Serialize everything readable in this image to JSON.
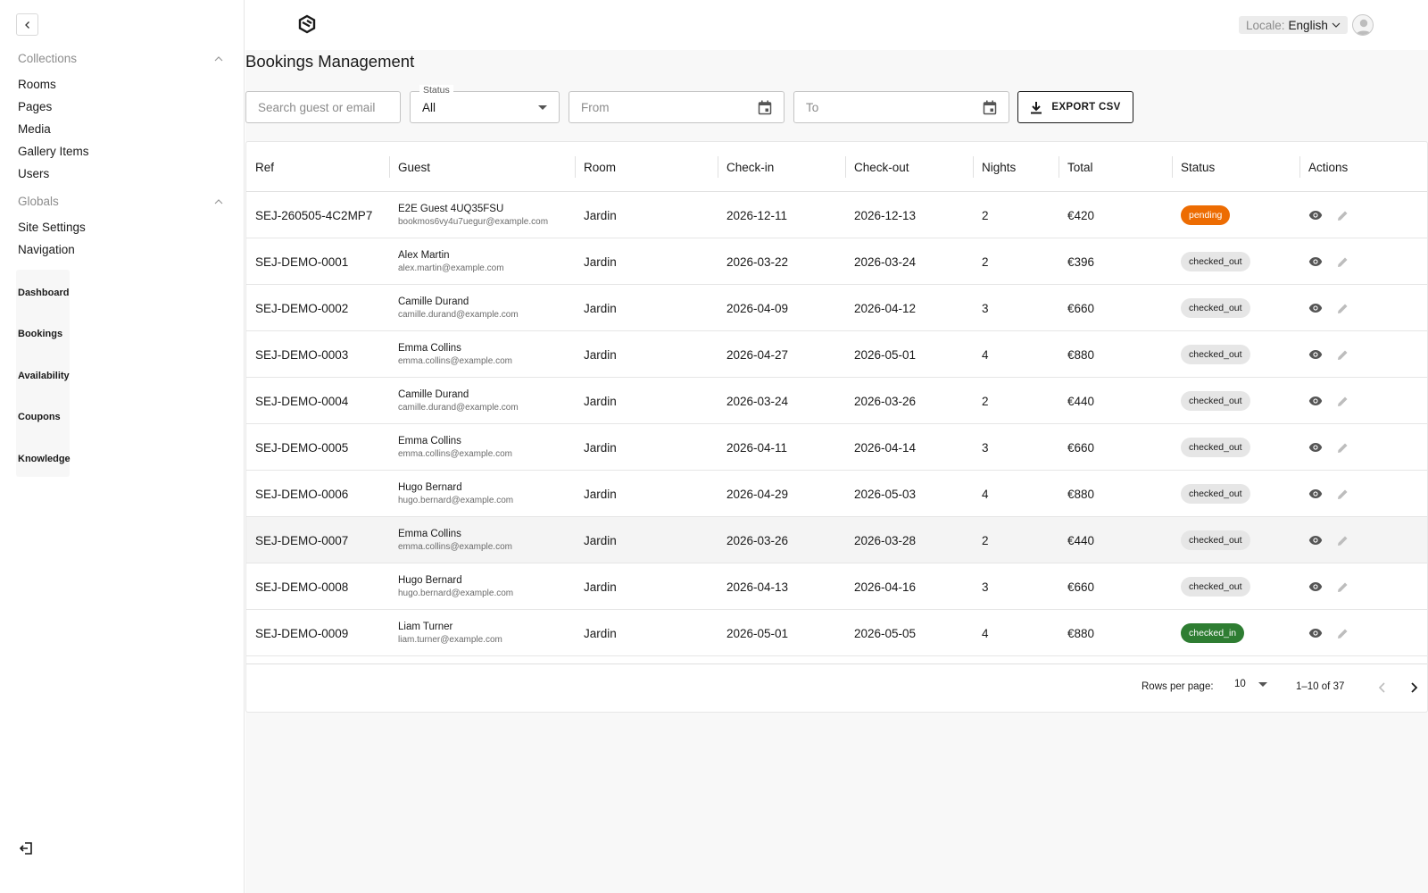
{
  "sidebar": {
    "groups": [
      {
        "title": "Collections",
        "items": [
          "Rooms",
          "Pages",
          "Media",
          "Gallery Items",
          "Users"
        ]
      },
      {
        "title": "Globals",
        "items": [
          "Site Settings",
          "Navigation"
        ]
      }
    ],
    "custom_links": [
      "Dashboard",
      "Bookings",
      "Availability",
      "Coupons",
      "Knowledge"
    ]
  },
  "header": {
    "locale_label": "Locale:",
    "locale_value": "English"
  },
  "page": {
    "title": "Bookings Management"
  },
  "filters": {
    "search_placeholder": "Search guest or email",
    "status_label": "Status",
    "status_value": "All",
    "from_placeholder": "From",
    "to_placeholder": "To",
    "export_label": "EXPORT CSV"
  },
  "table": {
    "columns": [
      "Ref",
      "Guest",
      "Room",
      "Check-in",
      "Check-out",
      "Nights",
      "Total",
      "Status",
      "Actions"
    ],
    "rows": [
      {
        "ref": "SEJ-260505-4C2MP7",
        "guest": "E2E Guest 4UQ35FSU",
        "email": "bookmos6vy4u7uegur@example.com",
        "room": "Jardin",
        "checkin": "2026-12-11",
        "checkout": "2026-12-13",
        "nights": "2",
        "total": "€420",
        "status": "pending"
      },
      {
        "ref": "SEJ-DEMO-0001",
        "guest": "Alex Martin",
        "email": "alex.martin@example.com",
        "room": "Jardin",
        "checkin": "2026-03-22",
        "checkout": "2026-03-24",
        "nights": "2",
        "total": "€396",
        "status": "checked_out"
      },
      {
        "ref": "SEJ-DEMO-0002",
        "guest": "Camille Durand",
        "email": "camille.durand@example.com",
        "room": "Jardin",
        "checkin": "2026-04-09",
        "checkout": "2026-04-12",
        "nights": "3",
        "total": "€660",
        "status": "checked_out"
      },
      {
        "ref": "SEJ-DEMO-0003",
        "guest": "Emma Collins",
        "email": "emma.collins@example.com",
        "room": "Jardin",
        "checkin": "2026-04-27",
        "checkout": "2026-05-01",
        "nights": "4",
        "total": "€880",
        "status": "checked_out"
      },
      {
        "ref": "SEJ-DEMO-0004",
        "guest": "Camille Durand",
        "email": "camille.durand@example.com",
        "room": "Jardin",
        "checkin": "2026-03-24",
        "checkout": "2026-03-26",
        "nights": "2",
        "total": "€440",
        "status": "checked_out"
      },
      {
        "ref": "SEJ-DEMO-0005",
        "guest": "Emma Collins",
        "email": "emma.collins@example.com",
        "room": "Jardin",
        "checkin": "2026-04-11",
        "checkout": "2026-04-14",
        "nights": "3",
        "total": "€660",
        "status": "checked_out"
      },
      {
        "ref": "SEJ-DEMO-0006",
        "guest": "Hugo Bernard",
        "email": "hugo.bernard@example.com",
        "room": "Jardin",
        "checkin": "2026-04-29",
        "checkout": "2026-05-03",
        "nights": "4",
        "total": "€880",
        "status": "checked_out"
      },
      {
        "ref": "SEJ-DEMO-0007",
        "guest": "Emma Collins",
        "email": "emma.collins@example.com",
        "room": "Jardin",
        "checkin": "2026-03-26",
        "checkout": "2026-03-28",
        "nights": "2",
        "total": "€440",
        "status": "checked_out"
      },
      {
        "ref": "SEJ-DEMO-0008",
        "guest": "Hugo Bernard",
        "email": "hugo.bernard@example.com",
        "room": "Jardin",
        "checkin": "2026-04-13",
        "checkout": "2026-04-16",
        "nights": "3",
        "total": "€660",
        "status": "checked_out"
      },
      {
        "ref": "SEJ-DEMO-0009",
        "guest": "Liam Turner",
        "email": "liam.turner@example.com",
        "room": "Jardin",
        "checkin": "2026-05-01",
        "checkout": "2026-05-05",
        "nights": "4",
        "total": "€880",
        "status": "checked_in"
      }
    ],
    "highlighted_row": 7
  },
  "pagination": {
    "rows_per_page_label": "Rows per page:",
    "rows_per_page_value": "10",
    "range": "1–10 of 37"
  },
  "colors": {
    "pending": "#ed6c02",
    "checked_in": "#2e7d32",
    "checked_out": "#e6e6e6"
  }
}
